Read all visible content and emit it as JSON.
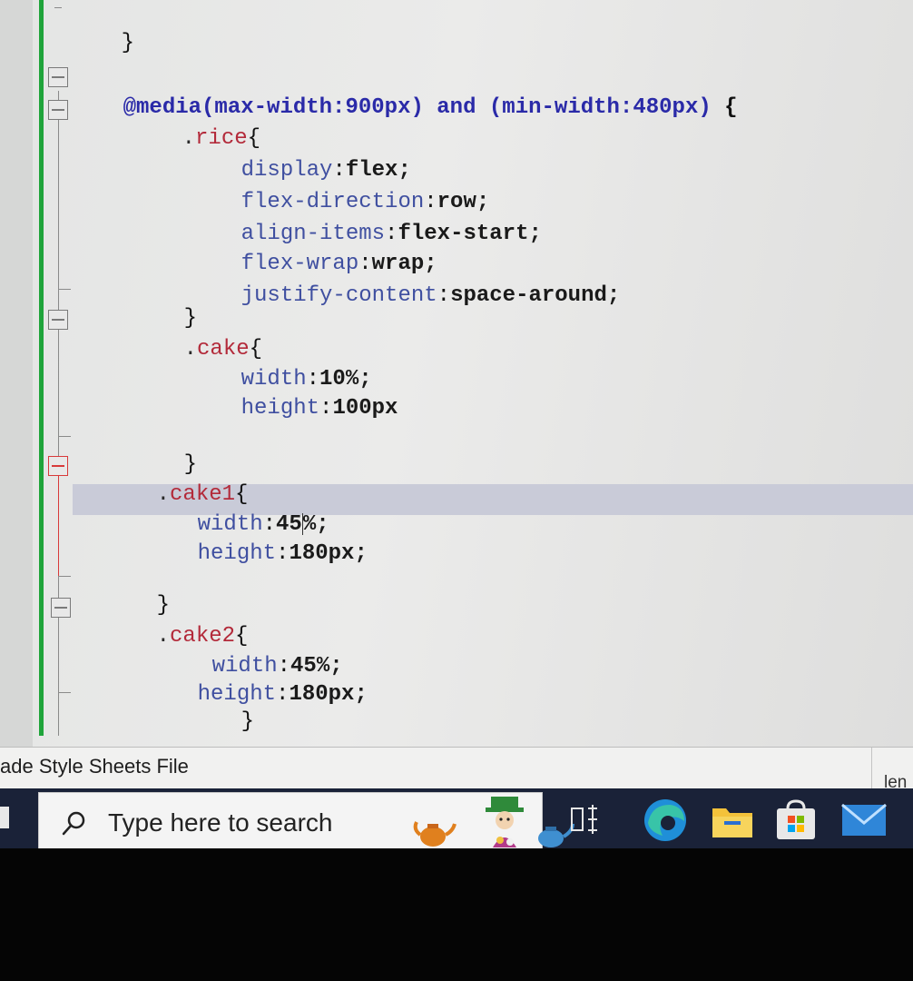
{
  "editor": {
    "lines": [
      {
        "text": "}"
      },
      {
        "segments": [
          "@media",
          "(max-width:900px)",
          "and",
          "(min-width:480px)",
          "{"
        ]
      },
      {
        "selector": "rice",
        "brace": "{"
      },
      {
        "prop": "display",
        "value": "flex;"
      },
      {
        "prop": "flex-direction",
        "value": "row;"
      },
      {
        "prop": "align-items",
        "value": "flex-start;"
      },
      {
        "prop": "flex-wrap",
        "value": "wrap;"
      },
      {
        "prop": "justify-content",
        "value": "space-around;"
      },
      {
        "text": "}"
      },
      {
        "selector": "cake",
        "brace": "{"
      },
      {
        "prop": "width",
        "value": "10%;"
      },
      {
        "prop": "height",
        "value": "100px"
      },
      {
        "text": "}"
      },
      {
        "selector": "cake1",
        "brace": "{"
      },
      {
        "prop": "width",
        "value_a": "45",
        "value_b": "%;"
      },
      {
        "prop": "height",
        "value": "180px;"
      },
      {
        "text": "}"
      },
      {
        "selector": "cake2",
        "brace": "{"
      },
      {
        "prop": "width",
        "value": "45%;"
      },
      {
        "prop": "height",
        "value": "180px;"
      },
      {
        "text": "}"
      }
    ]
  },
  "statusbar": {
    "file_type": "ade Style Sheets File",
    "right_text": "len"
  },
  "taskbar": {
    "search_placeholder": "Type here to search",
    "icons": [
      "task-view-icon",
      "edge-icon",
      "file-explorer-icon",
      "store-icon",
      "mail-icon"
    ]
  }
}
